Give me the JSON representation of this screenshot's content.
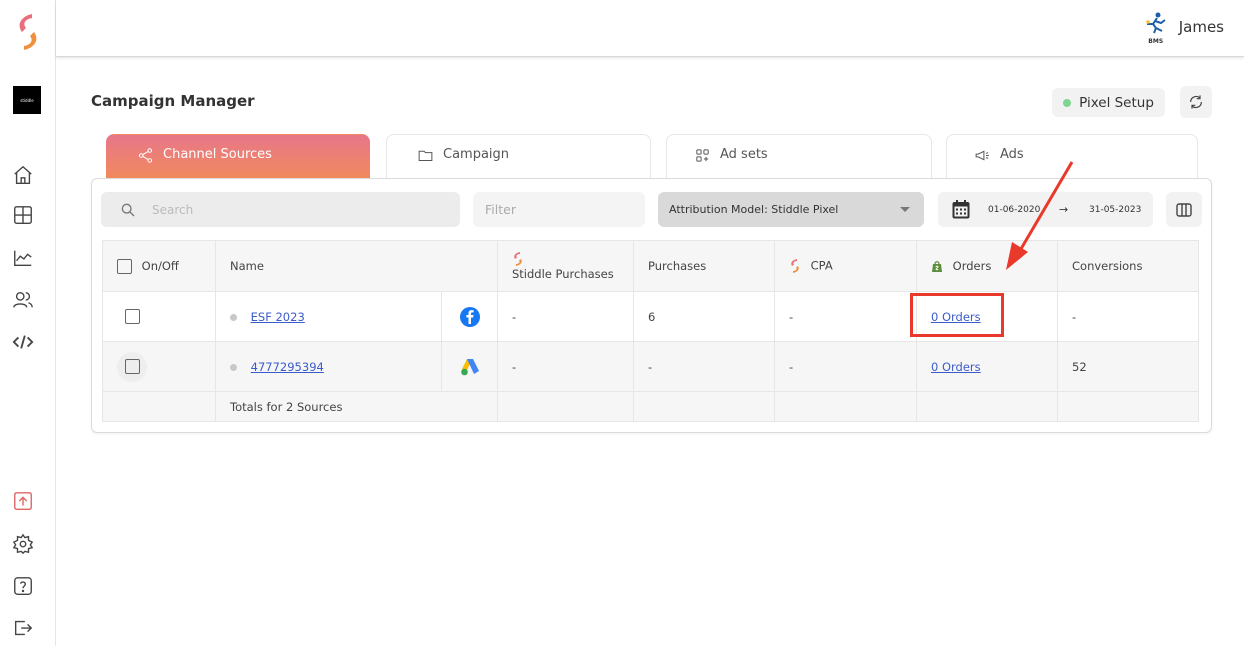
{
  "brand": {
    "thumb_text": "stiddle"
  },
  "user": {
    "name": "James",
    "avatar_caption": "BMS"
  },
  "page": {
    "title": "Campaign Manager"
  },
  "actions": {
    "pixel_setup_label": "Pixel Setup",
    "pixel_status_color": "#7ed68f"
  },
  "tabs": [
    {
      "label": "Channel Sources",
      "icon": "share-icon",
      "active": true
    },
    {
      "label": "Campaign",
      "icon": "folder-icon",
      "active": false
    },
    {
      "label": "Ad sets",
      "icon": "grid-plus-icon",
      "active": false
    },
    {
      "label": "Ads",
      "icon": "megaphone-icon",
      "active": false
    }
  ],
  "toolbar": {
    "search_placeholder": "Search",
    "filter_placeholder": "Filter",
    "attribution_label": "Attribution Model: Stiddle Pixel",
    "date_from": "01-06-2020",
    "date_to": "31-05-2023",
    "date_arrow": "→"
  },
  "table": {
    "headers": {
      "onoff": "On/Off",
      "name": "Name",
      "stiddle_purchases": "Stiddle Purchases",
      "purchases": "Purchases",
      "cpa": "CPA",
      "orders": "Orders",
      "conversions": "Conversions"
    },
    "rows": [
      {
        "name": "ESF 2023",
        "channel": "facebook",
        "stiddle_purchases": "-",
        "purchases": "6",
        "cpa": "-",
        "orders": "0 Orders",
        "conversions": "-"
      },
      {
        "name": "4777295394",
        "channel": "google-ads",
        "stiddle_purchases": "-",
        "purchases": "-",
        "cpa": "-",
        "orders": "0 Orders",
        "conversions": "52"
      }
    ],
    "totals_label": "Totals for 2 Sources"
  },
  "annotation": {
    "color": "#e8392a",
    "target": "orders-link"
  },
  "colors": {
    "accent_gradient_start": "#e8768a",
    "accent_gradient_end": "#f08a5d",
    "link": "#3b5bcc"
  }
}
